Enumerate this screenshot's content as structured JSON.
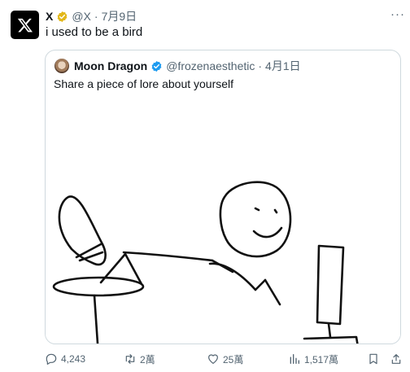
{
  "tweet": {
    "author_name": "X",
    "author_handle": "@X",
    "separator": "·",
    "date": "7月9日",
    "text": "i used to be a bird",
    "more_icon": "more-icon"
  },
  "quoted_tweet": {
    "author_name": "Moon Dragon",
    "author_handle": "@frozenaesthetic",
    "separator": "·",
    "date": "4月1日",
    "text": "Share a piece of lore about yourself"
  },
  "actions": {
    "replies": "4,243",
    "retweets": "2萬",
    "likes": "25萬",
    "views": "1,517萬"
  },
  "colors": {
    "verified_gold": "#e2b719",
    "verified_blue": "#1d9bf0",
    "muted_text": "#536471",
    "border": "#cfd9de"
  }
}
